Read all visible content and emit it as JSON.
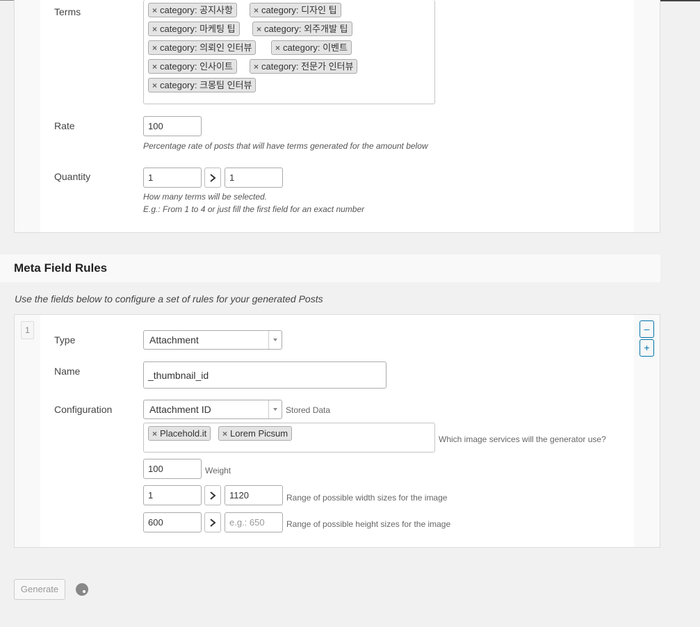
{
  "taxonomy": {
    "terms_label": "Terms",
    "terms": [
      "category: 공지사항",
      "category: 디자인 팁",
      "category: 마케팅 팁",
      "category: 외주개발 팁",
      "category: 의뢰인 인터뷰",
      "category: 이벤트",
      "category: 인사이트",
      "category: 전문가 인터뷰",
      "category: 크몽팀 인터뷰"
    ],
    "rate_label": "Rate",
    "rate_value": "100",
    "rate_help": "Percentage rate of posts that will have terms generated for the amount below",
    "quantity_label": "Quantity",
    "quantity_min": "1",
    "quantity_max": "1",
    "quantity_help_1": "How many terms will be selected.",
    "quantity_help_2": "E.g.: From 1 to 4 or just fill the first field for an exact number"
  },
  "meta": {
    "heading": "Meta Field Rules",
    "description": "Use the fields below to configure a set of rules for your generated Posts",
    "row_number": "1",
    "remove_label": "–",
    "add_label": "+",
    "type_label": "Type",
    "type_value": "Attachment",
    "name_label": "Name",
    "name_value": "_thumbnail_id",
    "config_label": "Configuration",
    "config_value": "Attachment ID",
    "config_note": "Stored Data",
    "services": [
      "Placehold.it",
      "Lorem Picsum"
    ],
    "services_note": "Which image services will the generator use?",
    "weight_value": "100",
    "weight_note": "Weight",
    "width_min": "1",
    "width_max": "1120",
    "width_note": "Range of possible width sizes for the image",
    "height_min": "600",
    "height_placeholder": "e.g.: 650",
    "height_note": "Range of possible height sizes for the image"
  },
  "generate_label": "Generate",
  "icons": {
    "remove_tag": "×",
    "range_arrow": "chevron-right-icon",
    "spinner": "spinner-icon"
  }
}
